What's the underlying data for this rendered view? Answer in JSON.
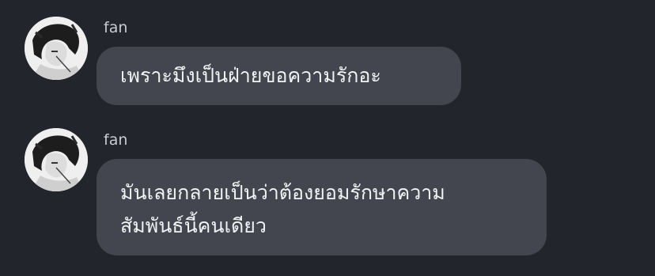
{
  "messages": [
    {
      "sender": "fan",
      "avatar_icon": "profile-avatar-illustration",
      "text": "เพราะมึงเป็นฝ่ายขอความรักอะ"
    },
    {
      "sender": "fan",
      "avatar_icon": "profile-avatar-illustration",
      "text": "มันเลยกลายเป็นว่าต้องยอมรักษาความ\nสัมพันธ์นี้คนเดียว"
    }
  ],
  "colors": {
    "background": "#23252c",
    "bubble": "#43464f",
    "text": "#f1f2f4",
    "sender": "#c9cbd1"
  }
}
